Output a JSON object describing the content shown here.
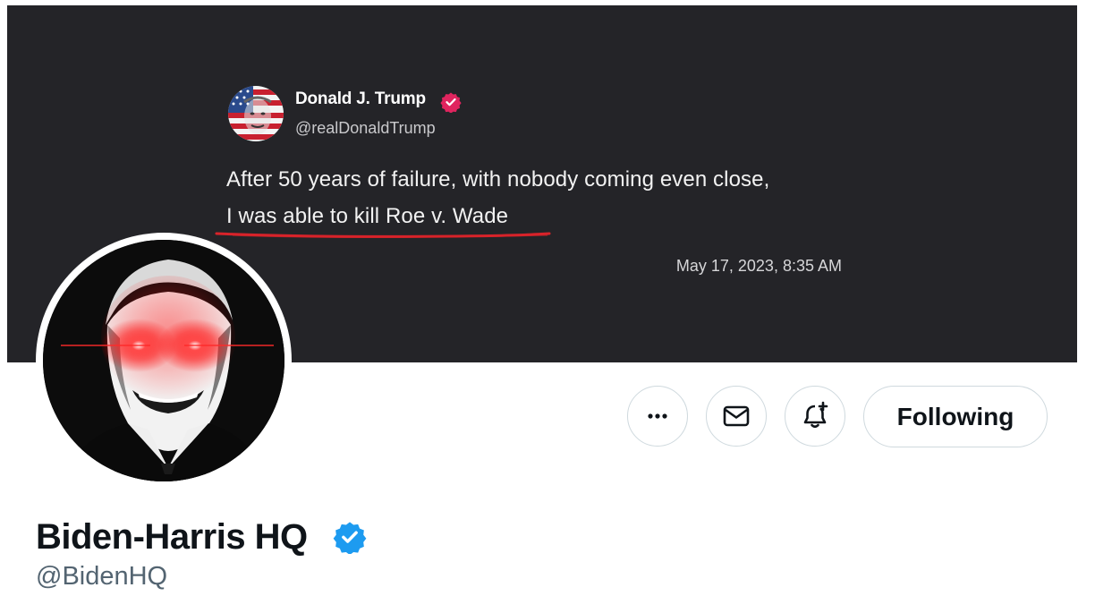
{
  "banner": {
    "quoted_post": {
      "author_name": "Donald J. Trump",
      "author_handle": "@realDonaldTrump",
      "text_line1": "After 50 years of failure, with nobody coming even close,",
      "text_line2": "I was able to kill Roe v. Wade",
      "timestamp": "May 17, 2023, 8:35 AM",
      "badge_color": "#e0245e",
      "underline_color": "#d8232a"
    }
  },
  "profile": {
    "display_name": "Biden-Harris HQ",
    "handle": "@BidenHQ",
    "verified_badge_color": "#1d9bf0"
  },
  "actions": {
    "more_icon": "more-horizontal-icon",
    "message_icon": "envelope-icon",
    "notify_icon": "bell-plus-icon",
    "follow_label": "Following"
  }
}
